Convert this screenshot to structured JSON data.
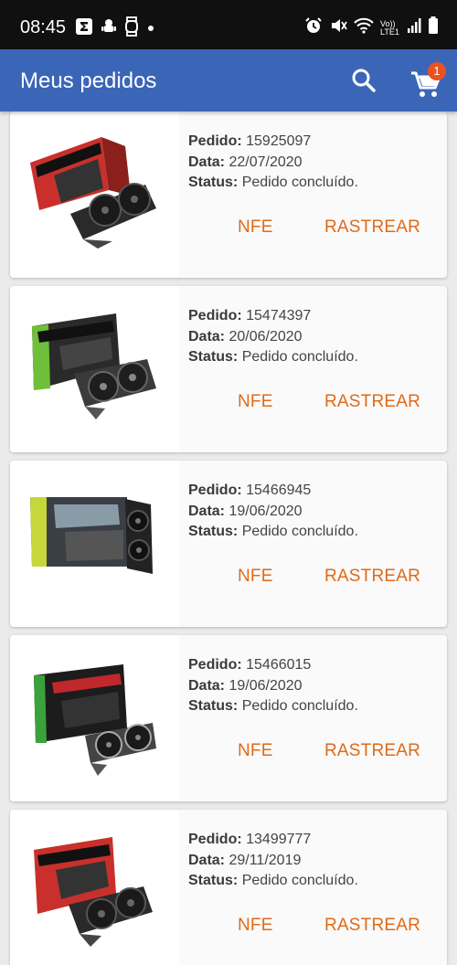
{
  "status_bar": {
    "time": "08:45",
    "network_label": "Vo)) LTE1",
    "left_icons": [
      "sigma-app-icon",
      "android-icon",
      "watch-icon",
      "dot-icon"
    ],
    "right_icons": [
      "alarm-icon",
      "mute-icon",
      "wifi-icon",
      "signal-icon",
      "battery-icon"
    ]
  },
  "app_bar": {
    "title": "Meus pedidos",
    "cart_count": "1",
    "color": "#3b66b8"
  },
  "labels": {
    "order": "Pedido:",
    "date": "Data:",
    "status": "Status:",
    "nfe": "NFE",
    "track": "RASTREAR"
  },
  "accent_color": "#e06a18",
  "orders": [
    {
      "id": "15925097",
      "date": "22/07/2020",
      "status": "Pedido concluído.",
      "product_box_brand": "GIGABYTE",
      "box_color": "#c9302c"
    },
    {
      "id": "15474397",
      "date": "20/06/2020",
      "status": "Pedido concluído.",
      "product_box_brand": "ASUS",
      "box_color": "#2a2a2a"
    },
    {
      "id": "15466945",
      "date": "19/06/2020",
      "status": "Pedido concluído.",
      "product_box_brand": "ZOTAC",
      "box_color": "#3a3f45"
    },
    {
      "id": "15466015",
      "date": "19/06/2020",
      "status": "Pedido concluído.",
      "product_box_brand": "msi",
      "box_color": "#1c1c1c"
    },
    {
      "id": "13499777",
      "date": "29/11/2019",
      "status": "Pedido concluído.",
      "product_box_brand": "GIGABYTE",
      "box_color": "#c9302c"
    }
  ]
}
